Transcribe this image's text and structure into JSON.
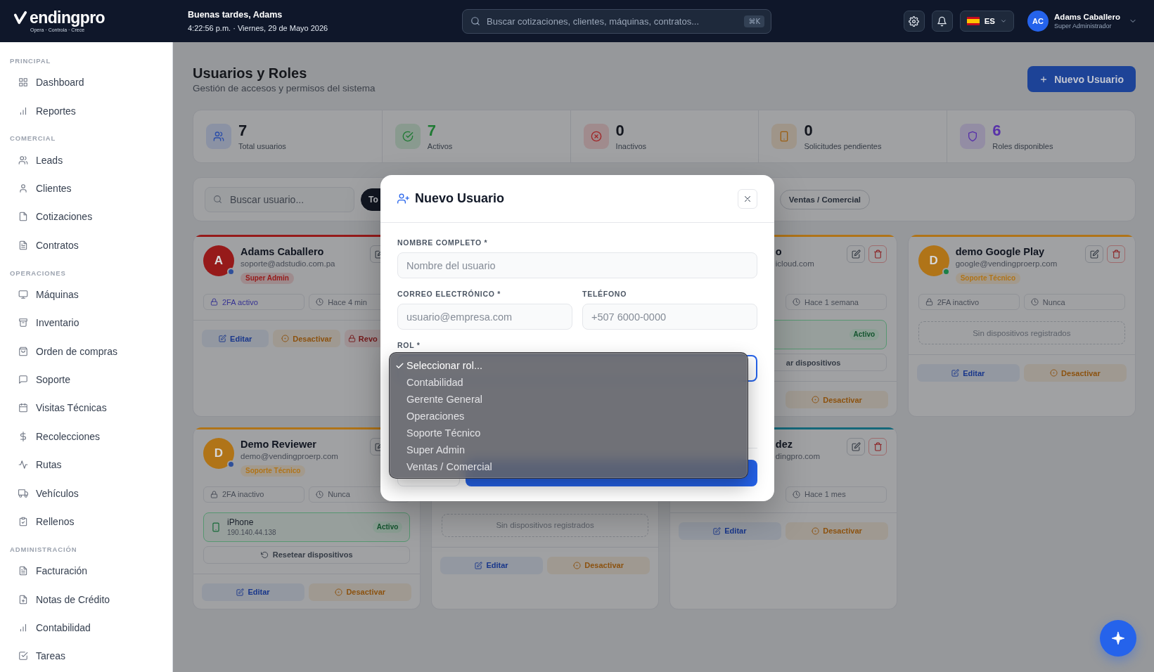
{
  "topbar": {
    "brand": "endingpro",
    "tagline": "Opera · Controla · Crece",
    "greeting": "Buenas tardes, Adams",
    "datetime": "4:22:56 p.m. · Viernes, 29 de Mayo 2026",
    "search": {
      "placeholder": "Buscar cotizaciones, clientes, máquinas, contratos...",
      "shortcut": "⌘K"
    },
    "language": "ES",
    "user": {
      "initials": "AC",
      "name": "Adams Caballero",
      "role": "Super Administrador"
    }
  },
  "sidebar": [
    {
      "title": "PRINCIPAL",
      "items": [
        {
          "label": "Dashboard",
          "kind": "dashboard",
          "selected": false
        },
        {
          "label": "Reportes",
          "kind": "reports",
          "selected": false
        }
      ]
    },
    {
      "title": "COMERCIAL",
      "items": [
        {
          "label": "Leads",
          "kind": "leads",
          "selected": false
        },
        {
          "label": "Clientes",
          "kind": "clients",
          "selected": false
        },
        {
          "label": "Cotizaciones",
          "kind": "quotes",
          "selected": false
        },
        {
          "label": "Contratos",
          "kind": "contracts",
          "selected": false
        }
      ]
    },
    {
      "title": "OPERACIONES",
      "items": [
        {
          "label": "Máquinas",
          "kind": "machines",
          "selected": false
        },
        {
          "label": "Inventario",
          "kind": "inventory",
          "selected": false
        },
        {
          "label": "Orden de compras",
          "kind": "purchases",
          "selected": false
        },
        {
          "label": "Soporte",
          "kind": "support",
          "selected": false
        },
        {
          "label": "Visitas Técnicas",
          "kind": "visits",
          "selected": false
        },
        {
          "label": "Recolecciones",
          "kind": "collections",
          "selected": false
        },
        {
          "label": "Rutas",
          "kind": "routes",
          "selected": false
        },
        {
          "label": "Vehículos",
          "kind": "vehicles",
          "selected": false
        },
        {
          "label": "Rellenos",
          "kind": "refills",
          "selected": false
        }
      ]
    },
    {
      "title": "ADMINISTRACIÓN",
      "items": [
        {
          "label": "Facturación",
          "kind": "billing",
          "selected": false
        },
        {
          "label": "Notas de Crédito",
          "kind": "credit",
          "selected": false
        },
        {
          "label": "Contabilidad",
          "kind": "accounting",
          "selected": false
        },
        {
          "label": "Tareas",
          "kind": "tasks",
          "selected": false
        }
      ]
    }
  ],
  "page": {
    "title": "Usuarios y Roles",
    "subtitle": "Gestión de accesos y permisos del sistema",
    "new_button": "Nuevo Usuario"
  },
  "stats": [
    {
      "kind": "users",
      "value": "7",
      "label": "Total usuarios",
      "color": "#8b92a4",
      "highlighted": false
    },
    {
      "kind": "active",
      "value": "7",
      "label": "Activos",
      "color": "#899a8f",
      "highlighted": true
    },
    {
      "kind": "inactive",
      "value": "0",
      "label": "Inactivos",
      "color": "#a08b8d",
      "highlighted": false
    },
    {
      "kind": "pending",
      "value": "0",
      "label": "Solicitudes pendientes",
      "color": "#9f9589",
      "highlighted": false
    },
    {
      "kind": "roles",
      "value": "6",
      "label": "Roles disponibles",
      "color": "#938da4",
      "highlighted": true
    }
  ],
  "filters": {
    "search_placeholder": "Buscar usuario...",
    "chips": [
      {
        "label": "To",
        "selected": true
      },
      {
        "label": "Ventas / Comercial",
        "selected": false
      }
    ]
  },
  "users": [
    {
      "kind": "full",
      "color": "#961a1a",
      "initial": "A",
      "dot": {
        "color": "#2f4f9a"
      },
      "name": "Adams Caballero",
      "email": "soporte@adstudio.com.pa",
      "role": "Super Admin",
      "tools": [
        {
          "kind": "edit"
        }
      ],
      "security": {
        "label": "2FA activo",
        "on": true
      },
      "last_seen": "Hace 4 min",
      "actions": [
        {
          "kind": "edit",
          "label": "Editar"
        },
        {
          "kind": "deactivate",
          "label": "Desactivar"
        },
        {
          "kind": "revoke",
          "label": "Revo"
        }
      ]
    },
    {
      "kind": "covered"
    },
    {
      "kind": "covered_left",
      "color": "#b07418",
      "name": "o",
      "email": "icloud.com",
      "tools": [
        {
          "kind": "edit"
        },
        {
          "kind": "delete"
        }
      ],
      "last_seen": "Hace 1 semana",
      "devices": [
        {
          "status": "Activo"
        }
      ],
      "reset": "ar dispositivos",
      "actions": [
        {
          "kind": "deactivate",
          "label": "Desactivar"
        }
      ]
    },
    {
      "kind": "full",
      "color": "#b07418",
      "initial": "D",
      "dot": {
        "color": "#1c8048"
      },
      "name": "demo Google Play",
      "email": "google@vendingproerp.com",
      "role": "Soporte Técnico",
      "tools": [
        {
          "kind": "edit"
        },
        {
          "kind": "delete"
        }
      ],
      "security": {
        "label": "2FA inactivo",
        "on": false
      },
      "last_seen": "Nunca",
      "no_devices": "Sin dispositivos registrados",
      "actions": [
        {
          "kind": "edit",
          "label": "Editar"
        },
        {
          "kind": "deactivate",
          "label": "Desactivar"
        }
      ]
    },
    {
      "kind": "full",
      "color": "#b07418",
      "initial": "D",
      "dot": {
        "color": "#2f4f9a"
      },
      "name": "Demo Reviewer",
      "email": "demo@vendingproerp.com",
      "role": "Soporte Técnico",
      "tools": [
        {
          "kind": "edit"
        }
      ],
      "security": {
        "label": "2FA inactivo",
        "on": false
      },
      "last_seen": "Nunca",
      "devices": [
        {
          "name": "iPhone",
          "ip": "190.140.44.138",
          "status": "Activo"
        }
      ],
      "reset": "Resetear dispositivos",
      "actions": [
        {
          "kind": "edit",
          "label": "Editar"
        },
        {
          "kind": "deactivate",
          "label": "Desactivar"
        }
      ]
    },
    {
      "kind": "covered_top",
      "no_devices": "Sin dispositivos registrados",
      "actions": [
        {
          "kind": "edit",
          "label": "Editar"
        },
        {
          "kind": "deactivate",
          "label": "Desactivar"
        }
      ]
    },
    {
      "kind": "covered_left",
      "color": "#14687a",
      "name": "dez",
      "email": "dingpro.com",
      "tools": [
        {
          "kind": "edit"
        },
        {
          "kind": "delete"
        }
      ],
      "last_seen": "Hace 1 mes",
      "actions": [
        {
          "kind": "edit",
          "label": "Editar"
        },
        {
          "kind": "deactivate",
          "label": "Desactivar"
        }
      ]
    }
  ],
  "dialog": {
    "title": "Nuevo Usuario",
    "fields": [
      {
        "kind": "wide",
        "label": "NOMBRE COMPLETO *",
        "placeholder": "Nombre del usuario"
      },
      {
        "kind": "half",
        "label": "CORREO ELECTRÓNICO *",
        "placeholder": "usuario@empresa.com"
      },
      {
        "kind": "half",
        "label": "TELÉFONO",
        "placeholder": "+507 6000-0000"
      },
      {
        "kind": "select",
        "label": "ROL *",
        "expanded": true,
        "options": [
          {
            "label": "Seleccionar rol...",
            "selected": true
          },
          {
            "label": "Contabilidad",
            "selected": false
          },
          {
            "label": "Gerente General",
            "selected": false
          },
          {
            "label": "Operaciones",
            "selected": false
          },
          {
            "label": "Soporte Técnico",
            "selected": false
          },
          {
            "label": "Super Admin",
            "selected": false
          },
          {
            "label": "Ventas / Comercial",
            "selected": false
          }
        ]
      }
    ]
  }
}
